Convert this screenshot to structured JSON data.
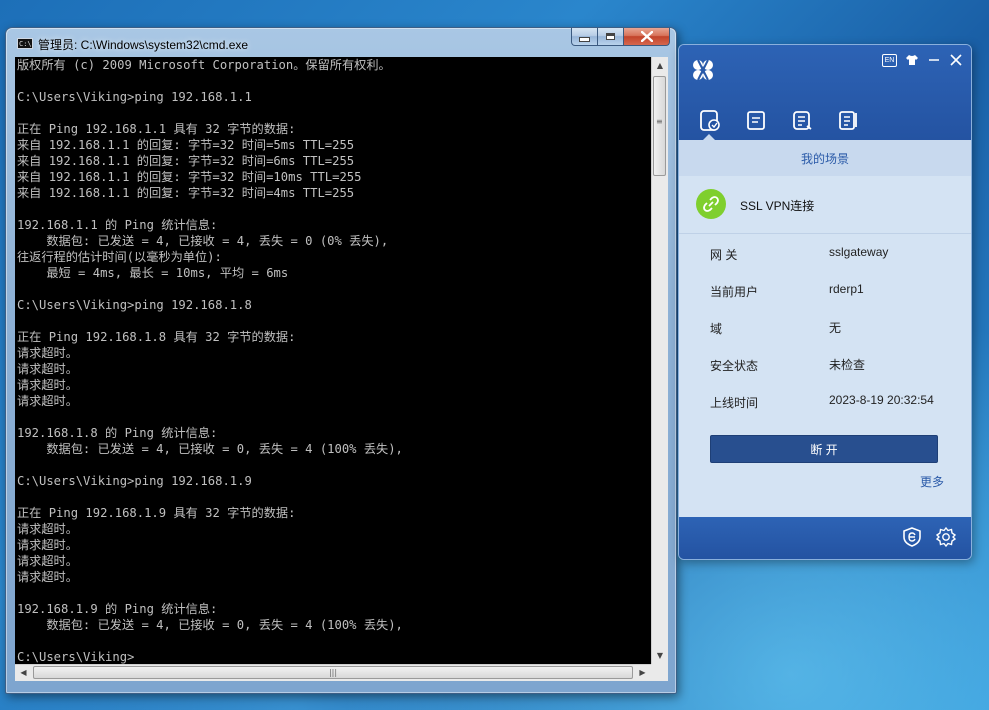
{
  "cmd": {
    "title": "管理员: C:\\Windows\\system32\\cmd.exe",
    "icon_text": "C:\\",
    "lines": [
      "版权所有 (c) 2009 Microsoft Corporation。保留所有权利。",
      "",
      "C:\\Users\\Viking>ping 192.168.1.1",
      "",
      "正在 Ping 192.168.1.1 具有 32 字节的数据:",
      "来自 192.168.1.1 的回复: 字节=32 时间=5ms TTL=255",
      "来自 192.168.1.1 的回复: 字节=32 时间=6ms TTL=255",
      "来自 192.168.1.1 的回复: 字节=32 时间=10ms TTL=255",
      "来自 192.168.1.1 的回复: 字节=32 时间=4ms TTL=255",
      "",
      "192.168.1.1 的 Ping 统计信息:",
      "    数据包: 已发送 = 4, 已接收 = 4, 丢失 = 0 (0% 丢失),",
      "往返行程的估计时间(以毫秒为单位):",
      "    最短 = 4ms, 最长 = 10ms, 平均 = 6ms",
      "",
      "C:\\Users\\Viking>ping 192.168.1.8",
      "",
      "正在 Ping 192.168.1.8 具有 32 字节的数据:",
      "请求超时。",
      "请求超时。",
      "请求超时。",
      "请求超时。",
      "",
      "192.168.1.8 的 Ping 统计信息:",
      "    数据包: 已发送 = 4, 已接收 = 0, 丢失 = 4 (100% 丢失),",
      "",
      "C:\\Users\\Viking>ping 192.168.1.9",
      "",
      "正在 Ping 192.168.1.9 具有 32 字节的数据:",
      "请求超时。",
      "请求超时。",
      "请求超时。",
      "请求超时。",
      "",
      "192.168.1.9 的 Ping 统计信息:",
      "    数据包: 已发送 = 4, 已接收 = 0, 丢失 = 4 (100% 丢失),",
      "",
      "C:\\Users\\Viking>"
    ]
  },
  "vpn": {
    "lang_badge": "EN",
    "scene_title": "我的场景",
    "connection_label": "SSL VPN连接",
    "info": [
      {
        "key": "网  关",
        "value": "sslgateway"
      },
      {
        "key": "当前用户",
        "value": "rderp1"
      },
      {
        "key": "域",
        "value": "无"
      },
      {
        "key": "安全状态",
        "value": "未检查"
      },
      {
        "key": "上线时间",
        "value": "2023-8-19 20:32:54"
      }
    ],
    "disconnect_label": "断 开",
    "more_label": "更多"
  },
  "colors": {
    "console_bg": "#000000",
    "console_text": "#c0c0c0",
    "vpn_primary": "#2a5aa8",
    "vpn_panel": "#d4e3f3",
    "link_green": "#7fcf2e"
  }
}
